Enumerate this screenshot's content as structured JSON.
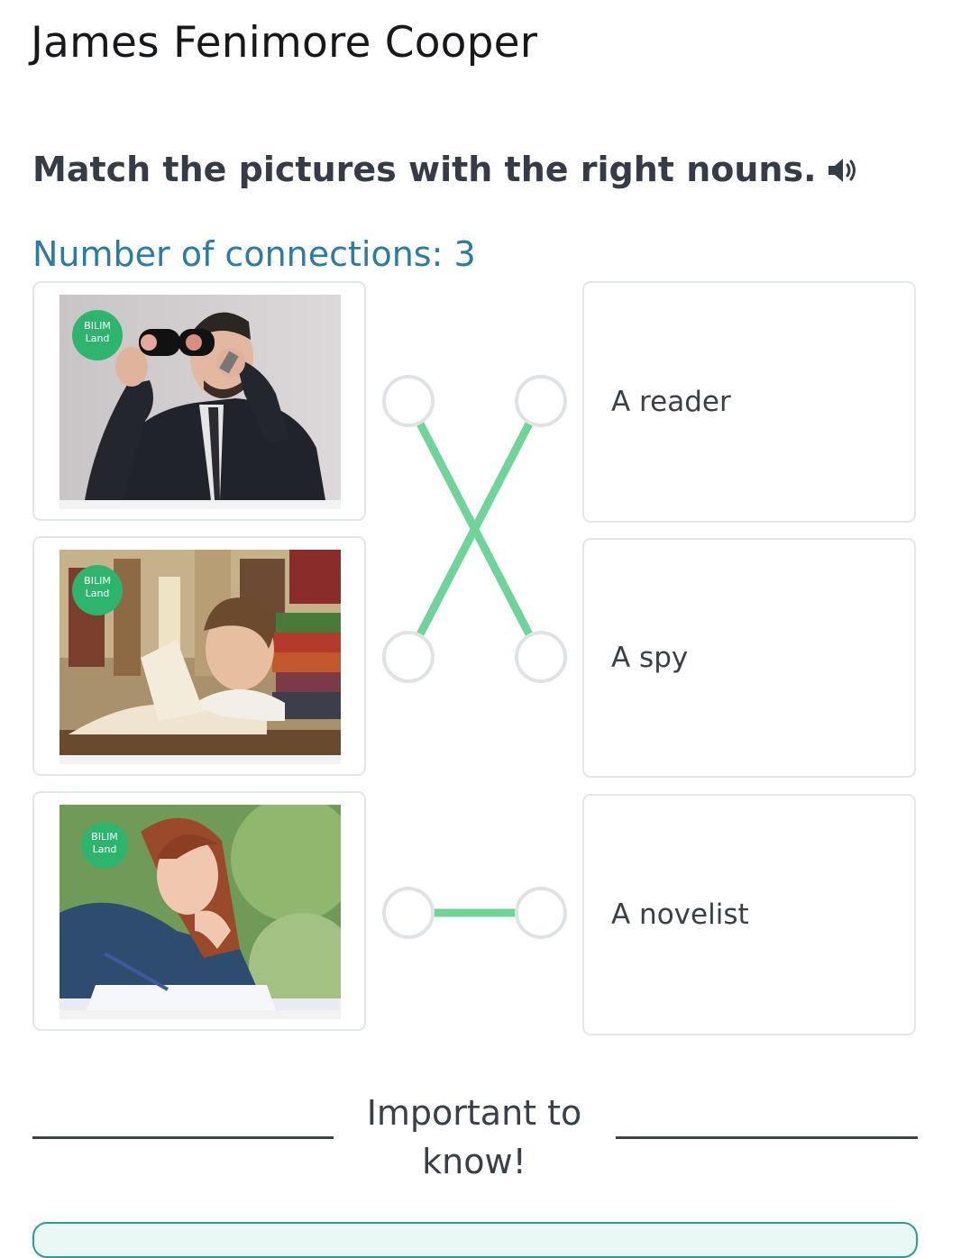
{
  "title": "James Fenimore Cooper",
  "instruction": "Match the pictures with the right nouns.",
  "connections_label": "Number of connections: 3",
  "icons": {
    "speaker": "speaker-icon",
    "logo": "bilimland-logo"
  },
  "logo_text": [
    "BILIM",
    "Land"
  ],
  "pictures": [
    {
      "name": "man-with-binoculars"
    },
    {
      "name": "boy-reading-book"
    },
    {
      "name": "woman-writing"
    }
  ],
  "nouns": [
    "A reader",
    "A spy",
    "A novelist"
  ],
  "connections": [
    {
      "picture": 0,
      "noun": 1
    },
    {
      "picture": 1,
      "noun": 0
    },
    {
      "picture": 2,
      "noun": 2
    }
  ],
  "colors": {
    "link": "#6fd497",
    "dot_border": "#dfe3e6",
    "heading_blue": "#2c7ba1",
    "logo_green": "#2db56e"
  },
  "important_label": "Important to know!"
}
